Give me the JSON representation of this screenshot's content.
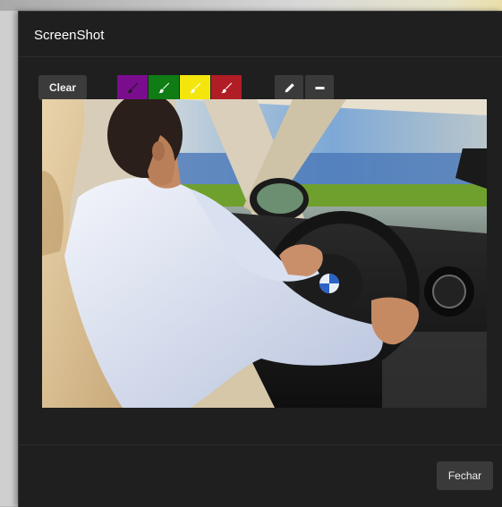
{
  "modal": {
    "title": "ScreenShot"
  },
  "toolbar": {
    "clear_label": "Clear",
    "swatches": [
      {
        "name": "purple",
        "color": "#7a0d8e",
        "icon": "brush-icon"
      },
      {
        "name": "green",
        "color": "#0f7d14",
        "icon": "brush-icon"
      },
      {
        "name": "yellow",
        "color": "#f4e60c",
        "icon": "brush-icon"
      },
      {
        "name": "red",
        "color": "#b11d25",
        "icon": "brush-icon"
      }
    ],
    "tools": [
      {
        "name": "pencil",
        "icon": "pencil-icon"
      },
      {
        "name": "line",
        "icon": "minus-icon"
      }
    ]
  },
  "image": {
    "subject": "man-driving-car-photo"
  },
  "footer": {
    "close_label": "Fechar"
  }
}
